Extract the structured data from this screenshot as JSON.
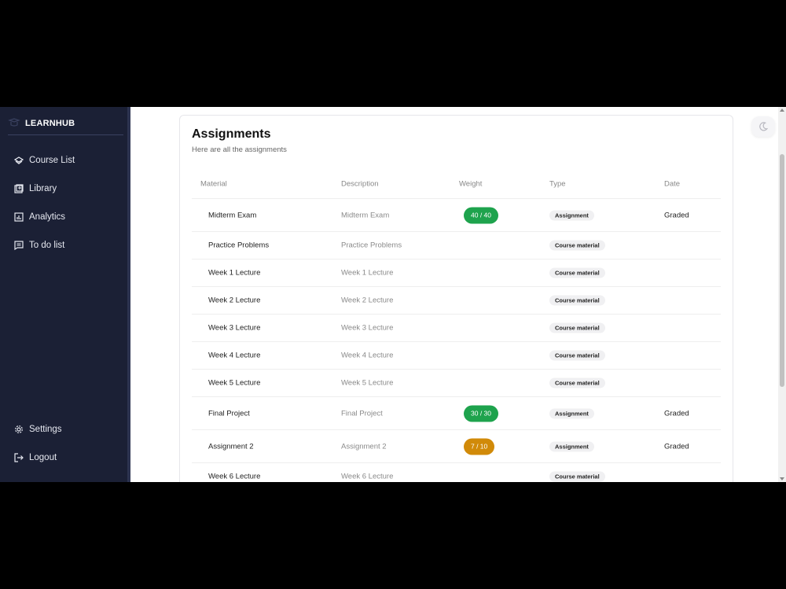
{
  "brand": {
    "name": "LEARNHUB"
  },
  "sidebar": {
    "items": [
      {
        "label": "Course List",
        "icon": "course-list-icon"
      },
      {
        "label": "Library",
        "icon": "library-icon"
      },
      {
        "label": "Analytics",
        "icon": "analytics-icon"
      },
      {
        "label": "To do list",
        "icon": "todo-list-icon"
      }
    ],
    "bottom": [
      {
        "label": "Settings",
        "icon": "gear-icon"
      },
      {
        "label": "Logout",
        "icon": "logout-icon"
      }
    ]
  },
  "page": {
    "title": "Assignments",
    "subtitle": "Here are all the assignments"
  },
  "table": {
    "headers": [
      "Material",
      "Description",
      "Weight",
      "Type",
      "Date"
    ],
    "rows": [
      {
        "material": "Midterm Exam",
        "description": "Midterm Exam",
        "weight": "40 / 40",
        "weight_color": "green",
        "type": "Assignment",
        "date": "Graded"
      },
      {
        "material": "Practice Problems",
        "description": "Practice Problems",
        "weight": "",
        "weight_color": "",
        "type": "Course material",
        "date": ""
      },
      {
        "material": "Week 1 Lecture",
        "description": "Week 1 Lecture",
        "weight": "",
        "weight_color": "",
        "type": "Course material",
        "date": ""
      },
      {
        "material": "Week 2 Lecture",
        "description": "Week 2 Lecture",
        "weight": "",
        "weight_color": "",
        "type": "Course material",
        "date": ""
      },
      {
        "material": "Week 3 Lecture",
        "description": "Week 3 Lecture",
        "weight": "",
        "weight_color": "",
        "type": "Course material",
        "date": ""
      },
      {
        "material": "Week 4 Lecture",
        "description": "Week 4 Lecture",
        "weight": "",
        "weight_color": "",
        "type": "Course material",
        "date": ""
      },
      {
        "material": "Week 5 Lecture",
        "description": "Week 5 Lecture",
        "weight": "",
        "weight_color": "",
        "type": "Course material",
        "date": ""
      },
      {
        "material": "Final Project",
        "description": "Final Project",
        "weight": "30 / 30",
        "weight_color": "green",
        "type": "Assignment",
        "date": "Graded"
      },
      {
        "material": "Assignment 2",
        "description": "Assignment 2",
        "weight": "7 / 10",
        "weight_color": "amber",
        "type": "Assignment",
        "date": "Graded"
      },
      {
        "material": "Week 6 Lecture",
        "description": "Week 6 Lecture",
        "weight": "",
        "weight_color": "",
        "type": "Course material",
        "date": ""
      }
    ]
  },
  "theme_toggle": {
    "icon": "moon-icon"
  },
  "colors": {
    "sidebar_bg": "#1b2035",
    "graded_green": "#1ea34d",
    "partial_amber": "#d18a09"
  }
}
